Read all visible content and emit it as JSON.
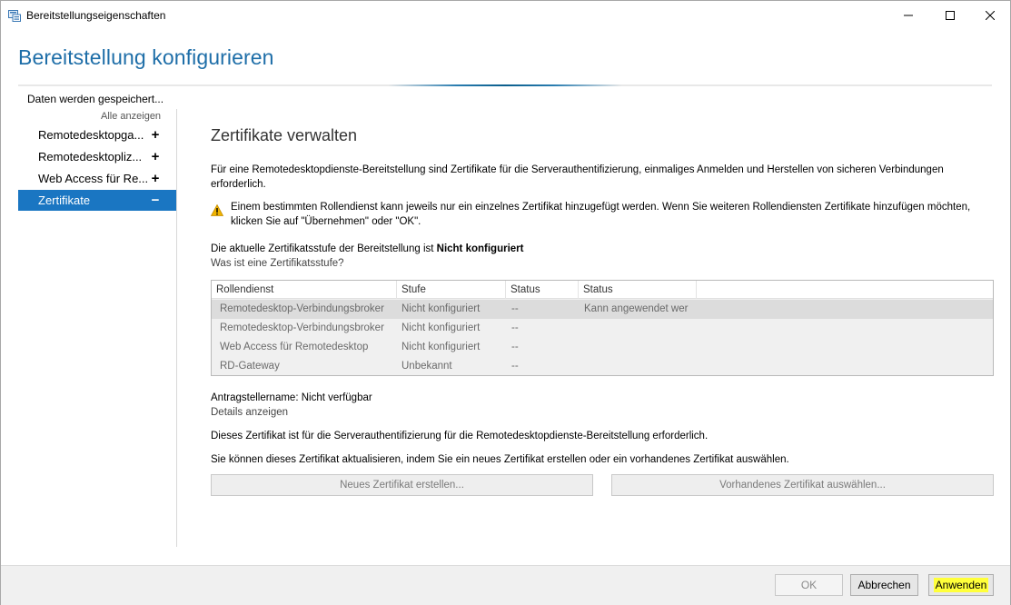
{
  "window": {
    "title": "Bereitstellungseigenschaften",
    "icon": "server-manager-icon"
  },
  "header": {
    "title": "Bereitstellung konfigurieren",
    "accent_color": "#1e6ea8"
  },
  "sidebar": {
    "status": "Daten werden gespeichert...",
    "show_all": "Alle anzeigen",
    "items": [
      {
        "label": "Remotedesktopga...",
        "sign": "+"
      },
      {
        "label": "Remotedesktopliz...",
        "sign": "+"
      },
      {
        "label": "Web Access für Re...",
        "sign": "+"
      },
      {
        "label": "Zertifikate",
        "sign": "−"
      }
    ],
    "active_color": "#1a76c2"
  },
  "main": {
    "title": "Zertifikate verwalten",
    "intro": "Für eine Remotedesktopdienste-Bereitstellung sind Zertifikate für die Serverauthentifizierung, einmaliges Anmelden und Herstellen von sicheren Verbindungen erforderlich.",
    "warning": "Einem bestimmten Rollendienst kann jeweils nur ein einzelnes Zertifikat hinzugefügt werden. Wenn Sie weiteren Rollendiensten Zertifikate hinzufügen möchten, klicken Sie auf \"Übernehmen\" oder \"OK\".",
    "level_prefix": "Die aktuelle Zertifikatsstufe der Bereitstellung ist ",
    "level_value": "Nicht konfiguriert",
    "level_link": "Was ist eine Zertifikatsstufe?",
    "table": {
      "columns": [
        "Rollendienst",
        "Stufe",
        "Status",
        "Status"
      ],
      "rows": [
        {
          "role": "Remotedesktop-Verbindungsbroker",
          "level": "Nicht konfiguriert",
          "status": "--",
          "status2": "Kann angewendet wer"
        },
        {
          "role": "Remotedesktop-Verbindungsbroker",
          "level": "Nicht konfiguriert",
          "status": "--",
          "status2": ""
        },
        {
          "role": "Web Access für Remotedesktop",
          "level": "Nicht konfiguriert",
          "status": "--",
          "status2": ""
        },
        {
          "role": "RD-Gateway",
          "level": "Unbekannt",
          "status": "--",
          "status2": ""
        }
      ]
    },
    "applicant": "Antragstellername: Nicht verfügbar",
    "details_link": "Details anzeigen",
    "desc1": "Dieses Zertifikat ist für die Serverauthentifizierung für die Remotedesktopdienste-Bereitstellung erforderlich.",
    "desc2": "Sie können dieses Zertifikat aktualisieren, indem Sie ein neues Zertifikat erstellen oder ein vorhandenes Zertifikat auswählen.",
    "btn_new": "Neues Zertifikat erstellen...",
    "btn_existing": "Vorhandenes Zertifikat auswählen..."
  },
  "footer": {
    "ok": "OK",
    "cancel": "Abbrechen",
    "apply": "Anwenden",
    "highlight_color": "#ffff3a"
  }
}
